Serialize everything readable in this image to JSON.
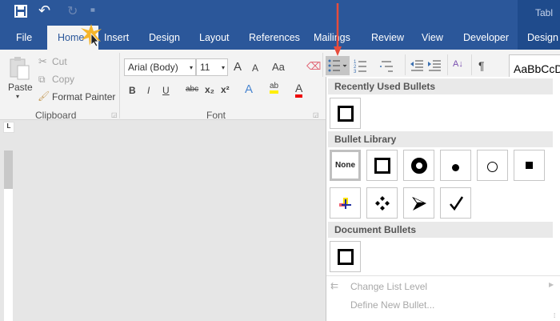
{
  "title_partial": "Tabl",
  "qat": {
    "save": "save-icon",
    "undo": "↶",
    "redo": "↻",
    "customize": "="
  },
  "tabs": [
    "File",
    "Home",
    "Insert",
    "Design",
    "Layout",
    "References",
    "Mailings",
    "Review",
    "View",
    "Developer",
    "Design"
  ],
  "clipboard": {
    "paste": "Paste",
    "cut": "Cut",
    "copy": "Copy",
    "format_painter": "Format Painter",
    "label": "Clipboard"
  },
  "font": {
    "name": "Arial (Body)",
    "size": "11",
    "grow": "A",
    "shrink": "A",
    "case": "Aa",
    "bold": "B",
    "italic": "I",
    "underline": "U",
    "strike": "abc",
    "sub": "x₂",
    "sup": "x²",
    "effects": "A",
    "highlight": "ab",
    "color": "A",
    "label": "Font"
  },
  "paragraph": {
    "sort": "A↓",
    "pilcrow": "¶"
  },
  "styles": {
    "preview": "AaBbCcD"
  },
  "bullets_panel": {
    "recent_header": "Recently Used Bullets",
    "library_header": "Bullet Library",
    "none_label": "None",
    "document_header": "Document Bullets",
    "change_level": "Change List Level",
    "define_new": "Define New Bullet..."
  },
  "colors": {
    "ribbon_blue": "#2b579a",
    "arrow": "#e74c3c"
  }
}
